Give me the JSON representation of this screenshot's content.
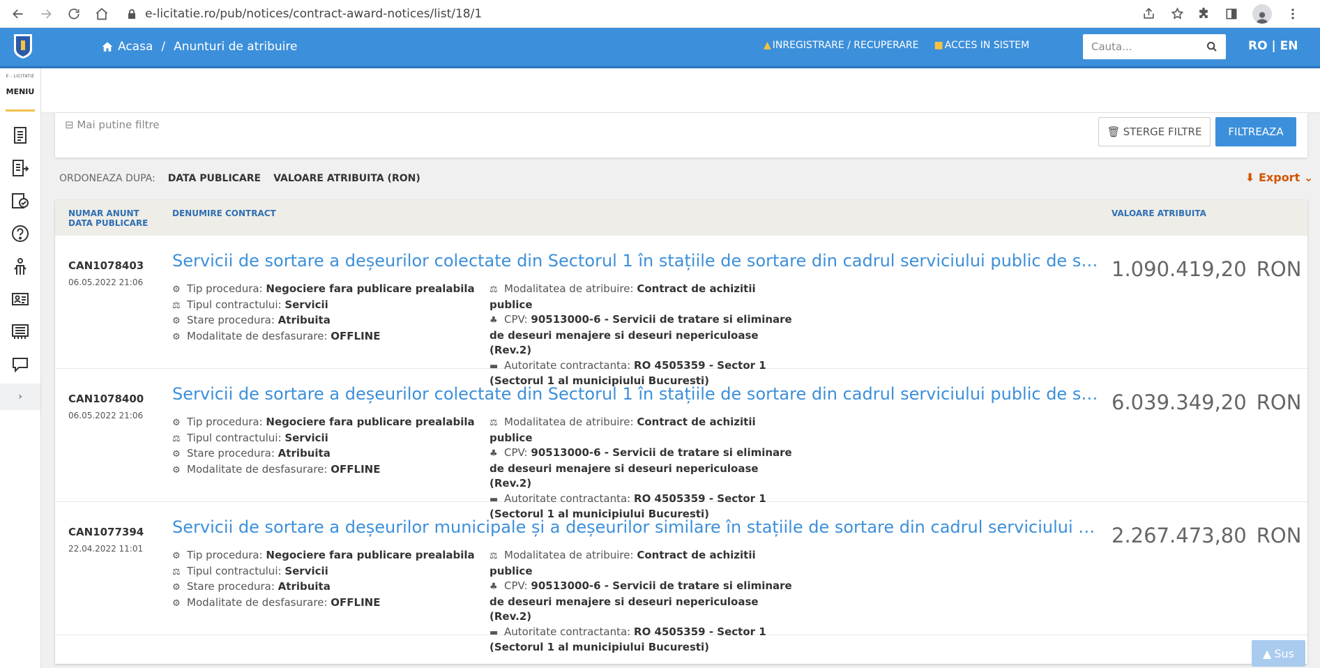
{
  "browser": {
    "url": "e-licitatie.ro/pub/notices/contract-award-notices/list/18/1",
    "icons": [
      "back-icon",
      "forward-icon",
      "reload-icon",
      "home-icon",
      "lock-icon",
      "share-icon",
      "star-icon",
      "extensions-icon",
      "sidepanel-icon",
      "profile-icon",
      "menu-icon"
    ]
  },
  "header": {
    "home_label": "Acasa",
    "current_label": "Anunturi de atribuire",
    "register_label": "INREGISTRARE / RECUPERARE",
    "login_label": "ACCES IN SISTEM",
    "search_placeholder": "Cauta...",
    "lang_label": "RO | EN",
    "accent_color": "#3c8fda"
  },
  "sidebar": {
    "brand_small": "E - LICITATIE",
    "menu_label": "MENIU",
    "expand_label": "›",
    "icons": [
      "notices-icon",
      "list-export-icon",
      "verified-doc-icon",
      "help-icon",
      "person-icon",
      "id-card-icon",
      "library-icon",
      "chat-icon"
    ]
  },
  "filters": {
    "less_label": "Mai putine filtre",
    "clear_label": "STERGE FILTRE",
    "filter_label": "FILTREAZA"
  },
  "sort": {
    "label": "ORDONEAZA DUPA:",
    "option1": "DATA PUBLICARE",
    "option2": "VALOARE ATRIBUITA (RON)",
    "export_label": "Export"
  },
  "table": {
    "col1_line1": "NUMAR ANUNT",
    "col1_line2": "DATA PUBLICARE",
    "col2": "DENUMIRE CONTRACT",
    "col3": "VALOARE ATRIBUITA",
    "field_labels": {
      "tip": "Tip procedura:",
      "tipul": "Tipul contractului:",
      "stare": "Stare procedura:",
      "modalitate": "Modalitate de desfasurare:",
      "atribuire": "Modalitatea de atribuire:",
      "cpv": "CPV:",
      "autoritate": "Autoritate contractanta:"
    },
    "rows": [
      {
        "number": "CAN1078403",
        "date": "06.05.2022 21:06",
        "title": "Servicii de sortare a deșeurilor colectate din Sectorul 1 în stațiile de sortare din cadrul serviciului public de salubrizare or…",
        "value": "1.090.419,20",
        "currency": "RON",
        "tip": "Negociere fara publicare prealabila",
        "tipul": "Servicii",
        "stare": "Atribuita",
        "modalitate": "OFFLINE",
        "atribuire": "Contract de achizitii publice",
        "cpv": "90513000-6 - Servicii de tratare si eliminare de deseuri menajere si deseuri nepericuloase (Rev.2)",
        "autoritate": "RO 4505359 - Sector 1 (Sectorul 1 al municipiului Bucuresti)"
      },
      {
        "number": "CAN1078400",
        "date": "06.05.2022 21:06",
        "title": "Servicii de sortare a deșeurilor colectate din Sectorul 1 în stațiile de sortare din cadrul serviciului public de salubrizare or…",
        "value": "6.039.349,20",
        "currency": "RON",
        "tip": "Negociere fara publicare prealabila",
        "tipul": "Servicii",
        "stare": "Atribuita",
        "modalitate": "OFFLINE",
        "atribuire": "Contract de achizitii publice",
        "cpv": "90513000-6 - Servicii de tratare si eliminare de deseuri menajere si deseuri nepericuloase (Rev.2)",
        "autoritate": "RO 4505359 - Sector 1 (Sectorul 1 al municipiului Bucuresti)"
      },
      {
        "number": "CAN1077394",
        "date": "22.04.2022 11:01",
        "title": "Servicii de sortare a deșeurilor municipale și a deșeurilor similare în stațiile de sortare din cadrul serviciului public de sal…",
        "value": "2.267.473,80",
        "currency": "RON",
        "tip": "Negociere fara publicare prealabila",
        "tipul": "Servicii",
        "stare": "Atribuita",
        "modalitate": "OFFLINE",
        "atribuire": "Contract de achizitii publice",
        "cpv": "90513000-6 - Servicii de tratare si eliminare de deseuri menajere si deseuri nepericuloase (Rev.2)",
        "autoritate": "RO 4505359 - Sector 1 (Sectorul 1 al municipiului Bucuresti)"
      }
    ]
  },
  "back_to_top_label": "Sus"
}
